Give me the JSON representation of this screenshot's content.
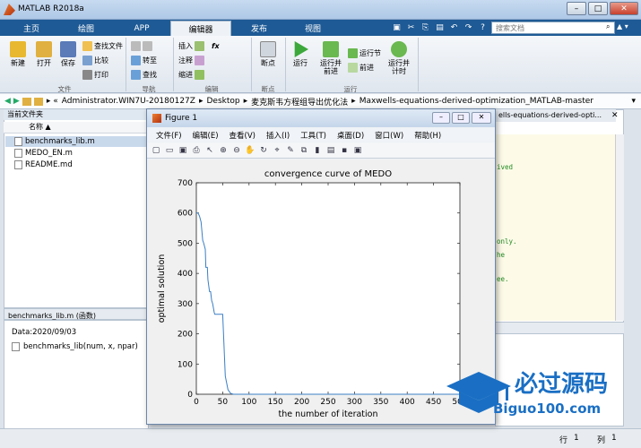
{
  "app": {
    "title": "MATLAB R2018a",
    "search_placeholder": "搜索文档"
  },
  "tabs": [
    "主页",
    "绘图",
    "APP",
    "编辑器",
    "发布",
    "视图"
  ],
  "ribbon": {
    "new": "新建",
    "open": "打开",
    "save": "保存",
    "find_files": "查找文件",
    "compare": "比较",
    "print": "打印",
    "goto": "转至",
    "find": "查找",
    "insert": "插入",
    "comment": "注释",
    "indent": "缩进",
    "fx": "fx",
    "breakpoints": "断点",
    "run": "运行",
    "run_advance": "运行并\n前进",
    "run_section": "运行节",
    "advance": "前进",
    "run_time": "运行并\n计时",
    "groups": [
      "文件",
      "导航",
      "编辑",
      "断点",
      "运行"
    ]
  },
  "address": {
    "segments": [
      "Administrator.WIN7U-20180127Z",
      "Desktop",
      "麦克斯韦方程组导出优化法",
      "Maxwells-equations-derived-optimization_MATLAB-master"
    ]
  },
  "current_folder": {
    "title": "当前文件夹",
    "column": "名称 ▲",
    "files": [
      {
        "name": "benchmarks_lib.m",
        "selected": true
      },
      {
        "name": "MEDO_EN.m",
        "selected": false
      },
      {
        "name": "README.md",
        "selected": false
      }
    ]
  },
  "details": {
    "header": "benchmarks_lib.m  (函数)",
    "date": "Data:2020/09/03",
    "signature": "benchmarks_lib(num, x, npar)"
  },
  "editor": {
    "tab_title": "ells-equations-derived-opti...",
    "fragments": [
      "ived",
      "only.",
      "he",
      "ee."
    ]
  },
  "status": {
    "row_label": "行",
    "row": "1",
    "col_label": "列",
    "col": "1"
  },
  "figure": {
    "title": "Figure 1",
    "menu": [
      "文件(F)",
      "编辑(E)",
      "查看(V)",
      "插入(I)",
      "工具(T)",
      "桌面(D)",
      "窗口(W)",
      "帮助(H)"
    ]
  },
  "watermark": {
    "cn": "必过源码",
    "en": "Biguo100.com"
  },
  "chart_data": {
    "type": "line",
    "title": "convergence curve of MEDO",
    "xlabel": "the number of iteration",
    "ylabel": "optimal solution",
    "xlim": [
      0,
      500
    ],
    "ylim": [
      0,
      700
    ],
    "xticks": [
      0,
      50,
      100,
      150,
      200,
      250,
      300,
      350,
      400,
      450,
      500
    ],
    "yticks": [
      0,
      100,
      200,
      300,
      400,
      500,
      600,
      700
    ],
    "x": [
      0,
      3,
      6,
      9,
      12,
      14,
      17,
      18,
      21,
      22,
      25,
      27,
      29,
      31,
      34,
      35,
      38,
      40,
      45,
      50,
      55,
      60,
      65,
      70,
      80,
      100,
      150,
      200,
      300,
      400,
      500
    ],
    "y": [
      600,
      600,
      590,
      570,
      510,
      500,
      480,
      420,
      420,
      380,
      340,
      340,
      310,
      300,
      270,
      265,
      265,
      265,
      265,
      265,
      60,
      15,
      3,
      0,
      0,
      0,
      0,
      0,
      0,
      0,
      0
    ],
    "color": "#3b7fc4",
    "grid": false
  }
}
